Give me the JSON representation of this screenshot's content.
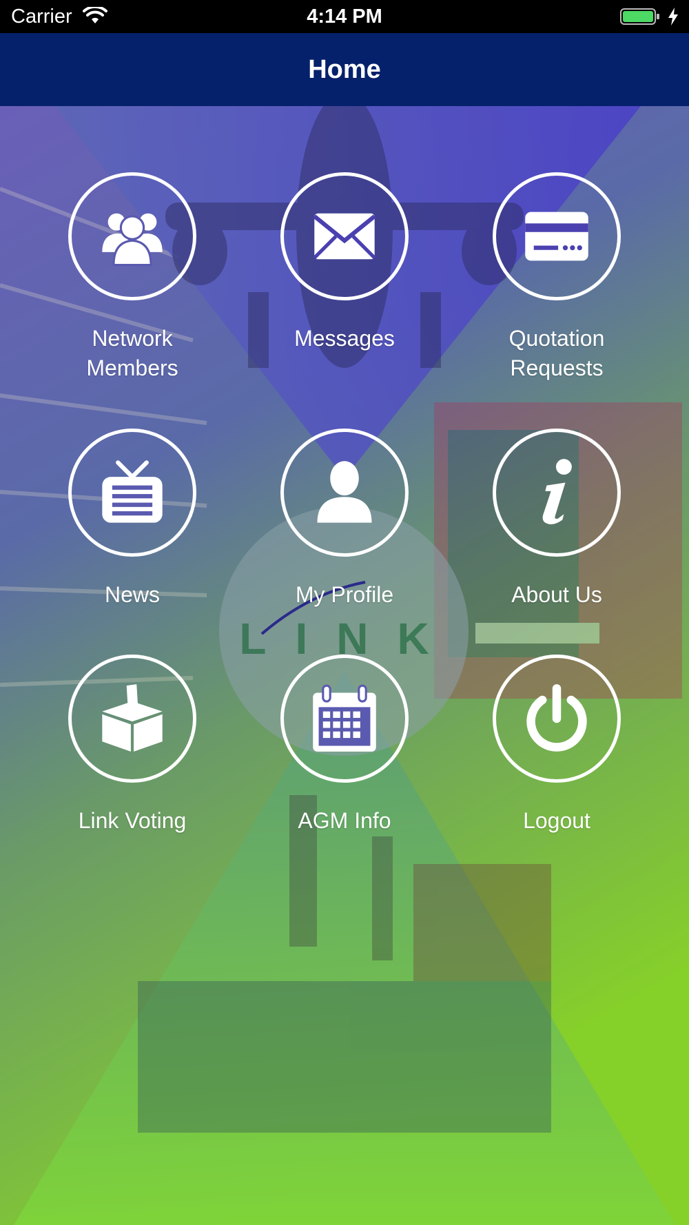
{
  "status_bar": {
    "carrier": "Carrier",
    "time": "4:14 PM",
    "icons": [
      "wifi-icon",
      "battery-icon",
      "charging-icon"
    ]
  },
  "nav": {
    "title": "Home"
  },
  "logo": {
    "text": "LINK"
  },
  "colors": {
    "nav_background": "#06216b",
    "gradient_top": "#4a3ec0",
    "gradient_bottom": "#7ed321",
    "icon_stroke": "#ffffff"
  },
  "tiles": [
    {
      "label": "Network\nMembers",
      "icon": "group-icon"
    },
    {
      "label": "Messages",
      "icon": "envelope-icon"
    },
    {
      "label": "Quotation\nRequests",
      "icon": "card-icon"
    },
    {
      "label": "News",
      "icon": "tv-icon"
    },
    {
      "label": "My Profile",
      "icon": "person-icon"
    },
    {
      "label": "About Us",
      "icon": "info-icon"
    },
    {
      "label": "Link Voting",
      "icon": "ballot-box-icon"
    },
    {
      "label": "AGM Info",
      "icon": "calendar-icon"
    },
    {
      "label": "Logout",
      "icon": "power-icon"
    }
  ]
}
